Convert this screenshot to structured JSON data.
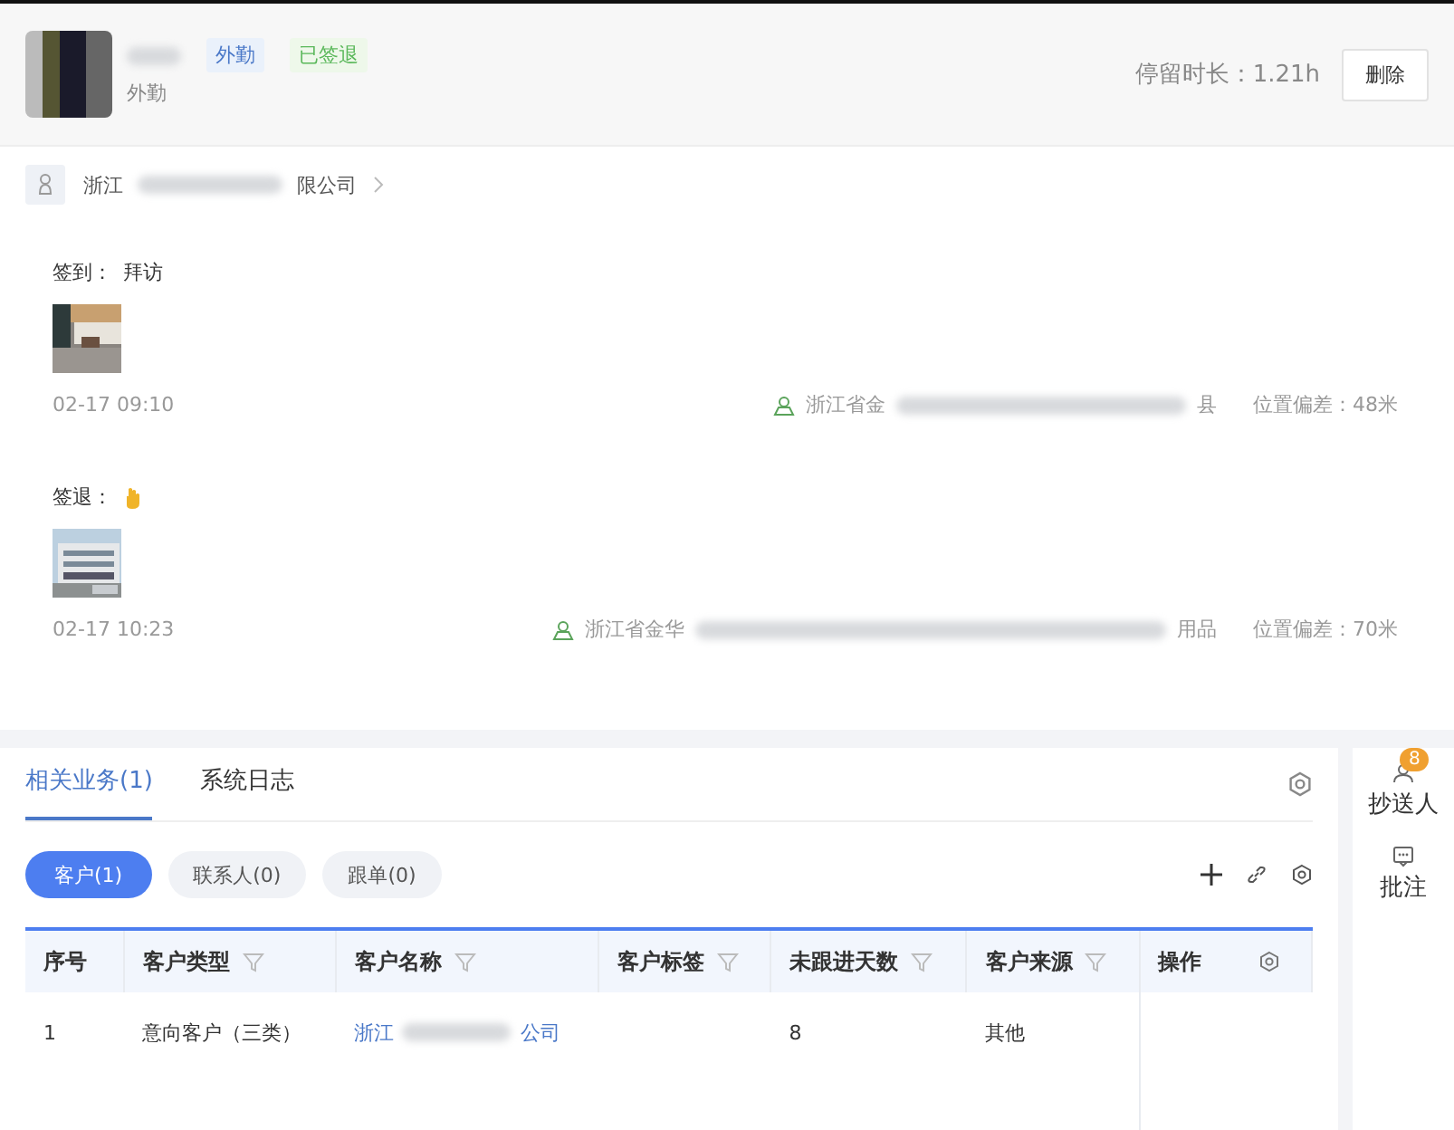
{
  "header": {
    "role": "外勤",
    "tags": [
      {
        "label": "外勤",
        "kind": "blue"
      },
      {
        "label": "已签退",
        "kind": "green"
      }
    ],
    "duration": "停留时长：1.21h",
    "delete_button": "删除"
  },
  "company": {
    "prefix": "浙江",
    "suffix": "限公司"
  },
  "records": [
    {
      "label": "签到：",
      "note": "拜访",
      "has_hand_icon": false,
      "time": "02-17 09:10",
      "address_prefix": "浙江省金",
      "address_suffix": "县",
      "deviation": "位置偏差：48米"
    },
    {
      "label": "签退：",
      "has_hand_icon": true,
      "time": "02-17 10:23",
      "address_prefix": "浙江省金华",
      "address_suffix": "用品",
      "deviation": "位置偏差：70米"
    }
  ],
  "tabs": [
    {
      "label": "相关业务(1)",
      "selected": true
    },
    {
      "label": "系统日志",
      "selected": false
    }
  ],
  "chips": [
    {
      "label": "客户(1)",
      "selected": true
    },
    {
      "label": "联系人(0)",
      "selected": false
    },
    {
      "label": "跟单(0)",
      "selected": false
    }
  ],
  "table": {
    "columns": [
      {
        "label": "序号",
        "filter": false
      },
      {
        "label": "客户类型",
        "filter": true
      },
      {
        "label": "客户名称",
        "filter": true
      },
      {
        "label": "客户标签",
        "filter": true
      },
      {
        "label": "未跟进天数",
        "filter": true
      },
      {
        "label": "客户来源",
        "filter": true
      },
      {
        "label": "操作",
        "filter": false
      }
    ],
    "rows": [
      {
        "index": "1",
        "type": "意向客户（三类）",
        "name_prefix": "浙江",
        "name_suffix": "公司",
        "days": "8",
        "source": "其他"
      }
    ]
  },
  "side": {
    "cc": "抄送人",
    "cc_badge": "8",
    "comment": "批注"
  }
}
